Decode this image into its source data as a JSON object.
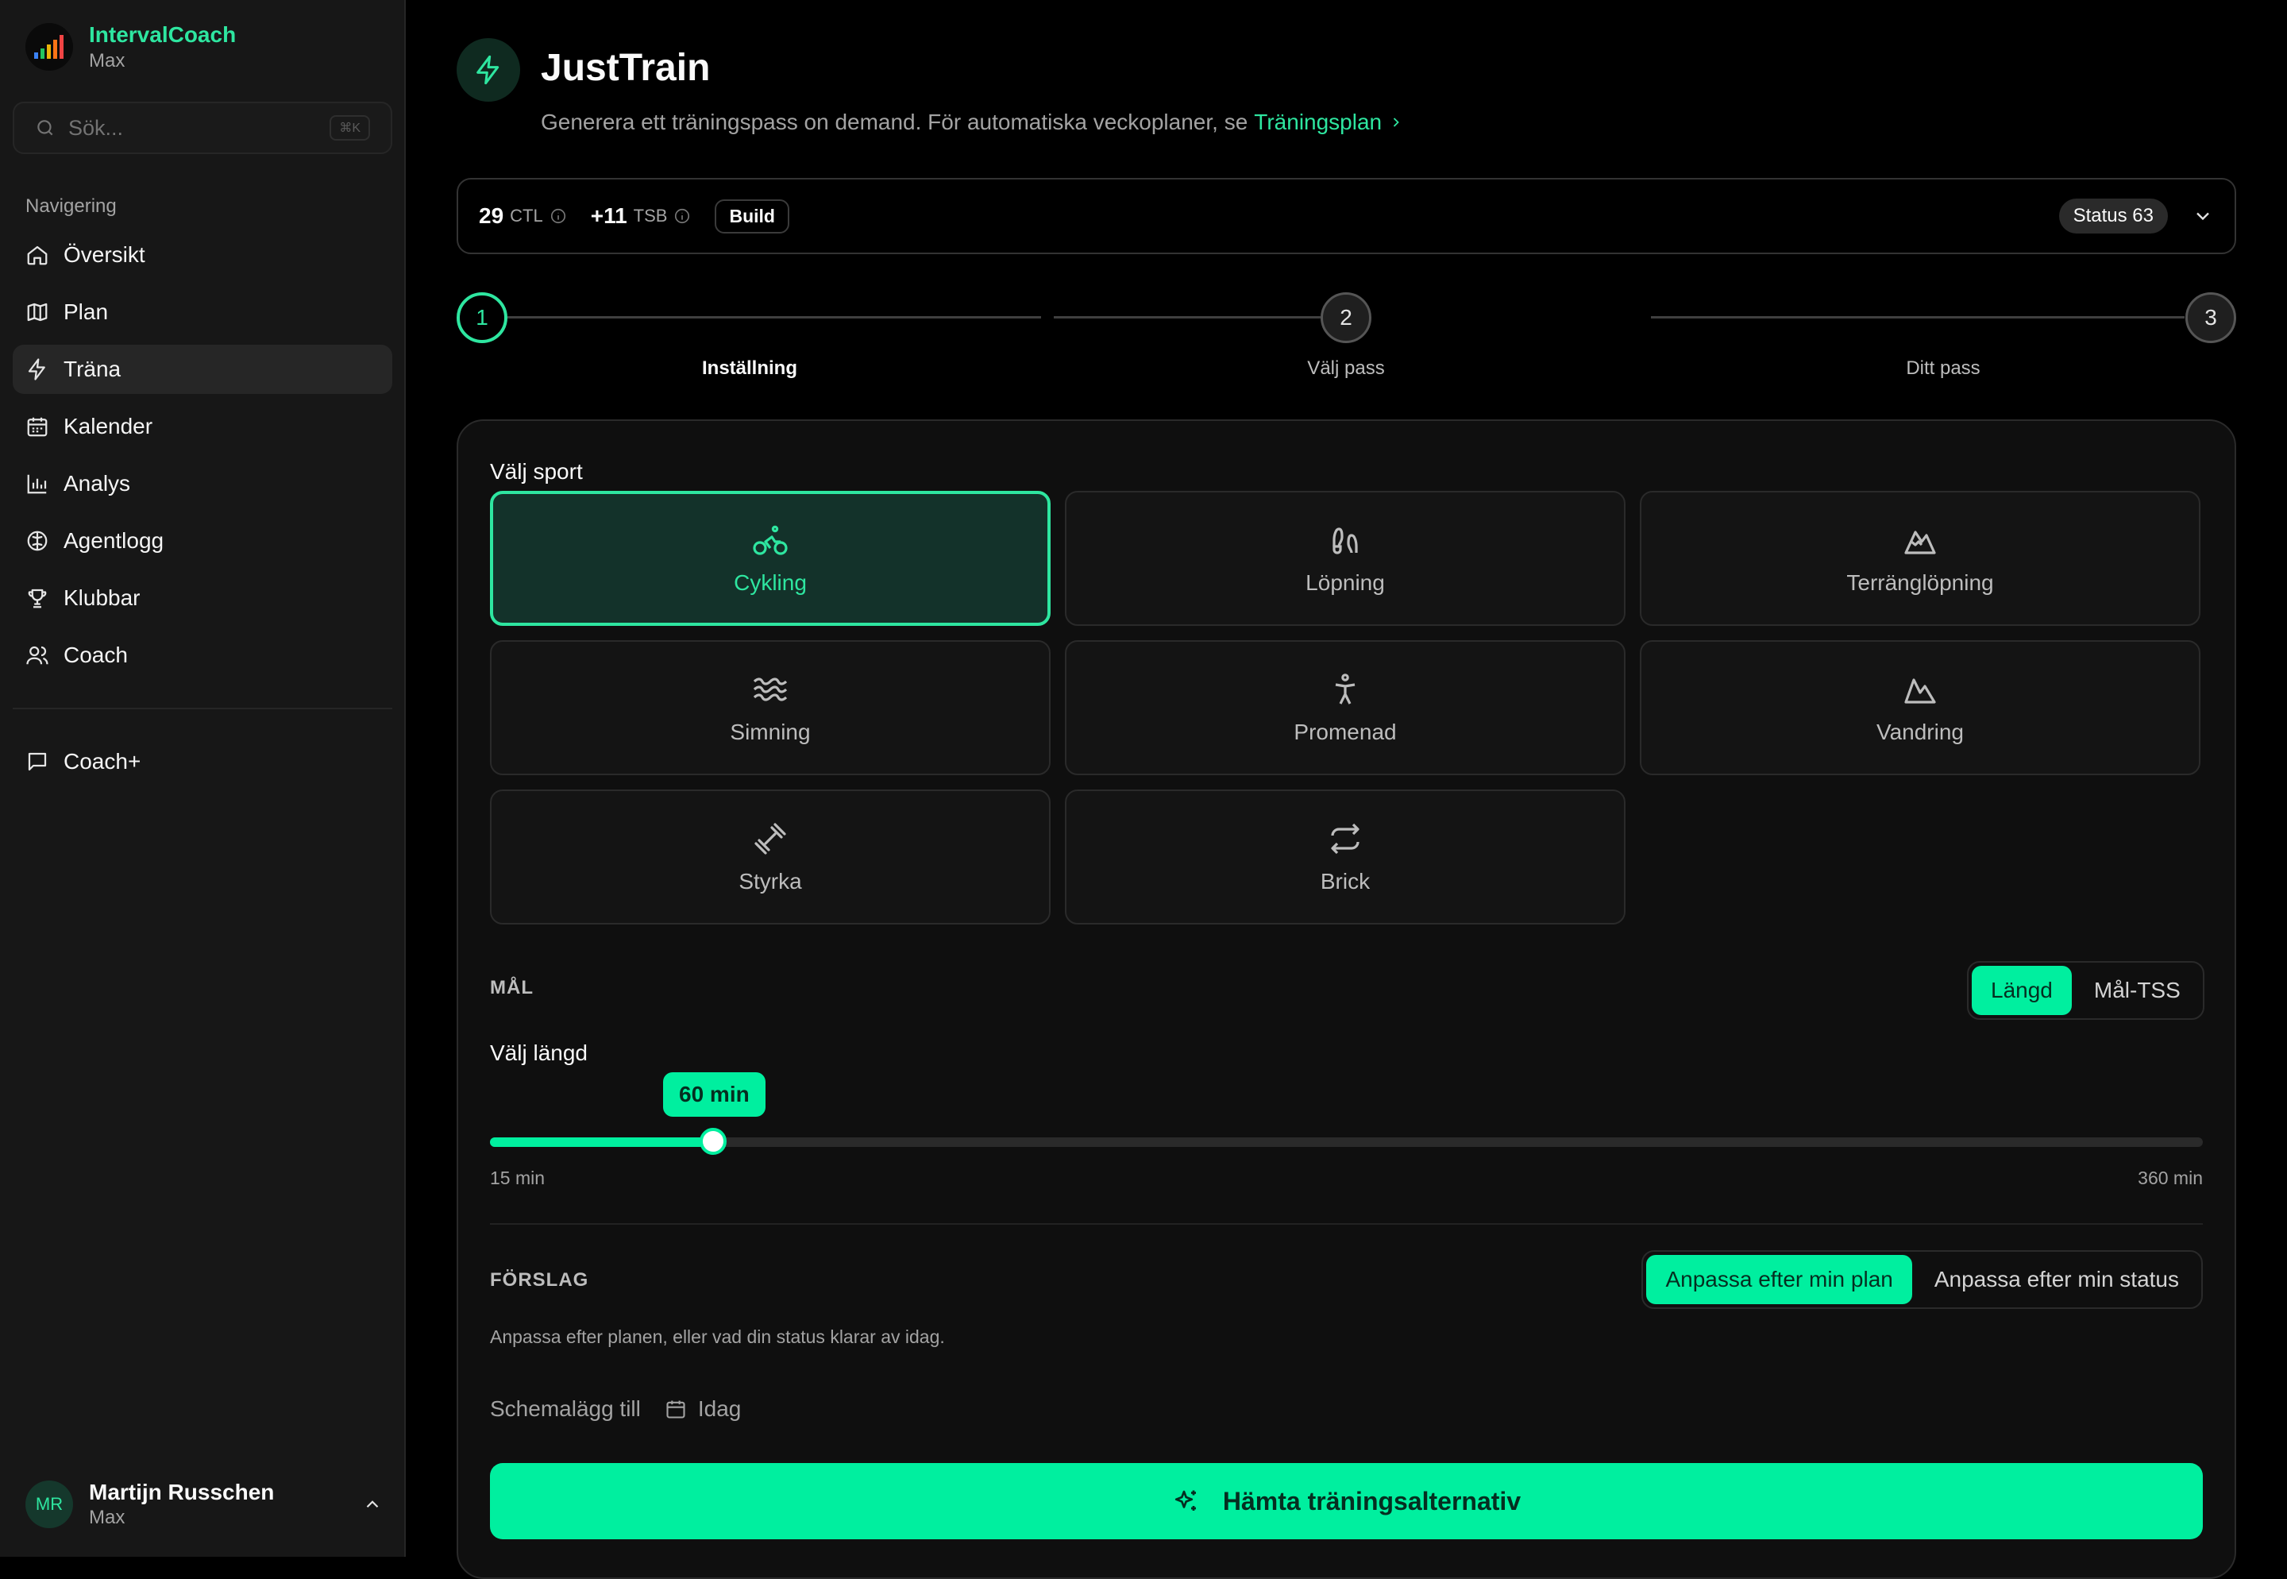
{
  "app": {
    "name": "IntervalCoach",
    "plan": "Max"
  },
  "sidebar": {
    "search_placeholder": "Sök...",
    "search_shortcut": "⌘K",
    "nav_heading": "Navigering",
    "items": [
      {
        "label": "Översikt",
        "icon": "home-icon"
      },
      {
        "label": "Plan",
        "icon": "map-icon"
      },
      {
        "label": "Träna",
        "icon": "bolt-icon",
        "active": true
      },
      {
        "label": "Kalender",
        "icon": "calendar-icon"
      },
      {
        "label": "Analys",
        "icon": "bar-chart-icon"
      },
      {
        "label": "Agentlogg",
        "icon": "brain-icon"
      },
      {
        "label": "Klubbar",
        "icon": "trophy-icon"
      },
      {
        "label": "Coach",
        "icon": "users-icon"
      }
    ],
    "secondary": [
      {
        "label": "Coach+",
        "icon": "chat-icon"
      }
    ],
    "user": {
      "initials": "MR",
      "name": "Martijn Russchen",
      "plan": "Max"
    }
  },
  "header": {
    "title": "JustTrain",
    "subtitle": "Generera ett träningspass on demand. För automatiska veckoplaner, se",
    "link": "Träningsplan"
  },
  "status_bar": {
    "ctl_value": "29",
    "ctl_label": "CTL",
    "tsb_value": "+11",
    "tsb_label": "TSB",
    "phase": "Build",
    "status": "Status 63"
  },
  "stepper": [
    {
      "number": "1",
      "label": "Inställning",
      "active": true
    },
    {
      "number": "2",
      "label": "Välj pass",
      "active": false
    },
    {
      "number": "3",
      "label": "Ditt pass",
      "active": false
    }
  ],
  "sport_section": {
    "label": "Välj sport",
    "options": [
      {
        "label": "Cykling",
        "icon": "bike-icon",
        "selected": true
      },
      {
        "label": "Löpning",
        "icon": "footprints-icon",
        "selected": false
      },
      {
        "label": "Terränglöpning",
        "icon": "mountain-snow-icon",
        "selected": false
      },
      {
        "label": "Simning",
        "icon": "waves-icon",
        "selected": false
      },
      {
        "label": "Promenad",
        "icon": "person-walking-icon",
        "selected": false
      },
      {
        "label": "Vandring",
        "icon": "mountain-icon",
        "selected": false
      },
      {
        "label": "Styrka",
        "icon": "dumbbell-icon",
        "selected": false
      },
      {
        "label": "Brick",
        "icon": "repeat-icon",
        "selected": false
      }
    ]
  },
  "goal": {
    "heading": "MÅL",
    "toggle": [
      {
        "label": "Längd",
        "active": true
      },
      {
        "label": "Mål-TSS",
        "active": false
      }
    ],
    "length_label": "Välj längd",
    "value_label": "60 min",
    "value": 60,
    "min": 15,
    "max": 360,
    "min_label": "15 min",
    "max_label": "360 min"
  },
  "suggestion": {
    "heading": "FÖRSLAG",
    "toggle": [
      {
        "label": "Anpassa efter min plan",
        "active": true
      },
      {
        "label": "Anpassa efter min status",
        "active": false
      }
    ],
    "hint": "Anpassa efter planen, eller vad din status klarar av idag."
  },
  "schedule": {
    "label": "Schemalägg till",
    "day": "Idag"
  },
  "cta": {
    "label": "Hämta träningsalternativ"
  },
  "colors": {
    "accent": "#00ef9f",
    "accent_text": "#2ee6a0",
    "background": "#000000",
    "sidebar": "#171717"
  }
}
